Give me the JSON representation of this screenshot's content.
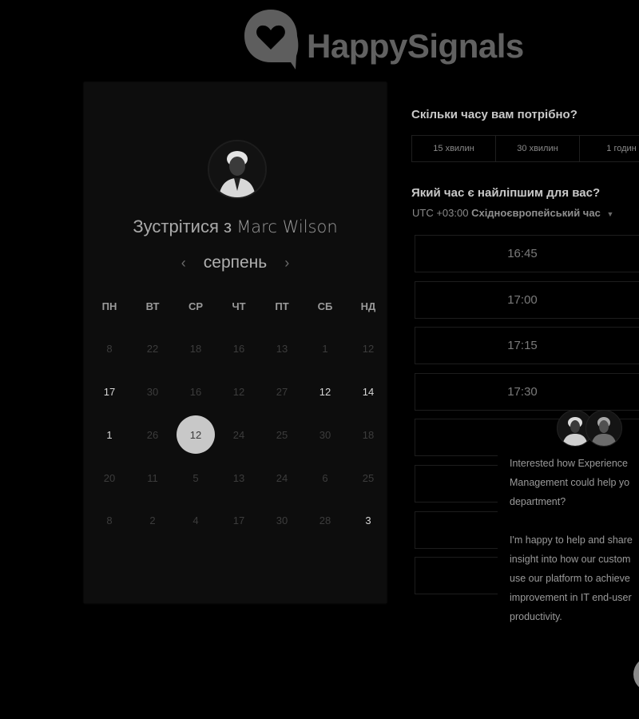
{
  "logo": {
    "text": "HappySignals"
  },
  "calendar": {
    "title_prefix": "Зустрітися з",
    "host_name": "Marc Wilson",
    "month": "серпень",
    "prev_icon": "‹",
    "next_icon": "›",
    "weekdays": [
      "ПН",
      "ВТ",
      "СР",
      "ЧТ",
      "ПТ",
      "СБ",
      "НД"
    ],
    "weeks": [
      [
        {
          "d": "8",
          "a": false
        },
        {
          "d": "22",
          "a": false
        },
        {
          "d": "18",
          "a": false
        },
        {
          "d": "16",
          "a": false
        },
        {
          "d": "13",
          "a": false
        },
        {
          "d": "1",
          "a": false
        },
        {
          "d": "12",
          "a": false
        }
      ],
      [
        {
          "d": "17",
          "a": true
        },
        {
          "d": "30",
          "a": false
        },
        {
          "d": "16",
          "a": false
        },
        {
          "d": "12",
          "a": false
        },
        {
          "d": "27",
          "a": false
        },
        {
          "d": "12",
          "a": true
        },
        {
          "d": "14",
          "a": true
        }
      ],
      [
        {
          "d": "1",
          "a": true
        },
        {
          "d": "26",
          "a": false
        },
        {
          "d": "12",
          "a": true,
          "s": true
        },
        {
          "d": "24",
          "a": false
        },
        {
          "d": "25",
          "a": false
        },
        {
          "d": "30",
          "a": false
        },
        {
          "d": "18",
          "a": false
        }
      ],
      [
        {
          "d": "20",
          "a": false
        },
        {
          "d": "11",
          "a": false
        },
        {
          "d": "5",
          "a": false
        },
        {
          "d": "13",
          "a": false
        },
        {
          "d": "24",
          "a": false
        },
        {
          "d": "6",
          "a": false
        },
        {
          "d": "25",
          "a": false
        }
      ],
      [
        {
          "d": "8",
          "a": false
        },
        {
          "d": "2",
          "a": false
        },
        {
          "d": "4",
          "a": false
        },
        {
          "d": "17",
          "a": false
        },
        {
          "d": "30",
          "a": false
        },
        {
          "d": "28",
          "a": false
        },
        {
          "d": "3",
          "a": true
        }
      ]
    ]
  },
  "duration": {
    "question": "Скільки часу вам потрібно?",
    "options": [
      "15 хвилин",
      "30 хвилин",
      "1 годин"
    ]
  },
  "time": {
    "question": "Який час є найліпшим для вас?",
    "tz_offset": "UTC +03:00",
    "tz_name": "Східноєвропейський час",
    "caret": "▼",
    "slots": [
      "16:45",
      "17:00",
      "17:15",
      "17:30"
    ]
  },
  "chat": {
    "message": "Interested how Experience\nManagement could help yo\ndepartment?\n\nI'm happy to help and share\ninsight into how our custom\nuse our platform to achieve\nimprovement in IT end-user\nproductivity."
  }
}
